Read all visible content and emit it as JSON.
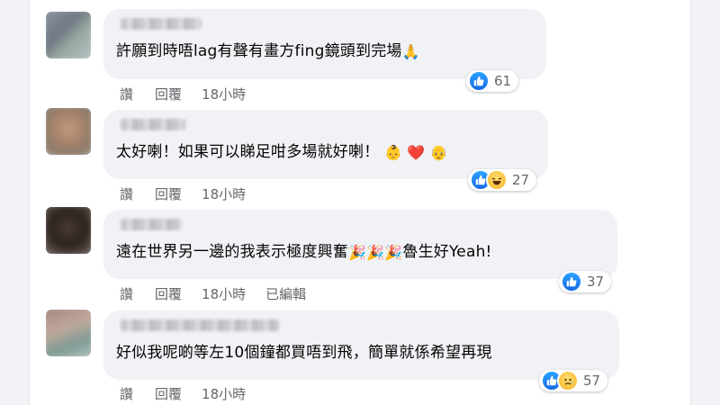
{
  "comments": [
    {
      "text": "許願到時唔lag有聲有畫方fing鏡頭到完場",
      "trailing_emoji": "🙏",
      "reaction_count": "61",
      "reactions": [
        "like"
      ],
      "actions": [
        "讚",
        "回覆",
        "18小時"
      ]
    },
    {
      "text": "太好喇！如果可以睇足咁多場就好喇！",
      "trailing_emoji": "👶 ❤️ 👴",
      "reaction_count": "27",
      "reactions": [
        "like",
        "haha"
      ],
      "actions": [
        "讚",
        "回覆",
        "18小時"
      ]
    },
    {
      "text": "遠在世界另一邊的我表示極度興奮",
      "middle_emoji": "🎉🎉🎉",
      "text_after": "魯生好Yeah!",
      "reaction_count": "37",
      "reactions": [
        "like"
      ],
      "actions": [
        "讚",
        "回覆",
        "18小時",
        "已編輯"
      ]
    },
    {
      "text": "好似我呢啲等左10個鐘都買唔到飛，簡單就係希望再現",
      "reaction_count": "57",
      "reactions": [
        "like",
        "sad"
      ],
      "actions": [
        "讚",
        "回覆",
        "18小時"
      ]
    }
  ],
  "colors": {
    "page_bg": "#f0f2f5",
    "bubble_bg": "#f0f2f5",
    "text": "#050505",
    "muted": "#65676b",
    "like_blue": "#1877f2"
  }
}
